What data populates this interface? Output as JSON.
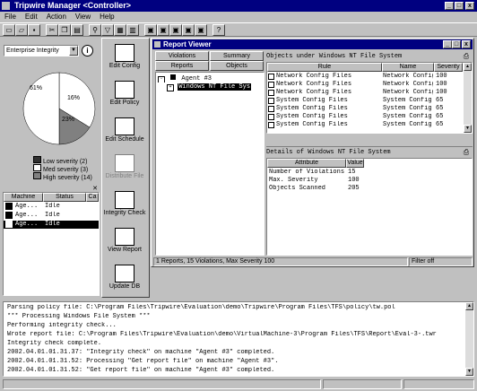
{
  "window": {
    "title": "Tripwire Manager <Controller>"
  },
  "menu": [
    "File",
    "Edit",
    "Action",
    "View",
    "Help"
  ],
  "filter": {
    "value": "Enterprise Integrity"
  },
  "pie": {
    "labels": [
      "61%",
      "16%",
      "23%"
    ],
    "legend": [
      {
        "label": "Low severity (2)",
        "color": "#303030"
      },
      {
        "label": "Med severity (3)",
        "color": "#ffffff"
      },
      {
        "label": "High severity (14)",
        "color": "#808080"
      }
    ]
  },
  "machines": {
    "columns": [
      "Machine",
      "Status",
      "Ca"
    ],
    "rows": [
      {
        "name": "Age...",
        "status": "Idle"
      },
      {
        "name": "Age...",
        "status": "Idle"
      },
      {
        "name": "Age...",
        "status": "Idle"
      }
    ]
  },
  "nav": [
    {
      "label": "Edit Config"
    },
    {
      "label": "Edit Policy"
    },
    {
      "label": "Edit Schedule"
    },
    {
      "label": "Distribute File"
    },
    {
      "label": "Integrity Check"
    },
    {
      "label": "View Report"
    },
    {
      "label": "Update DB"
    }
  ],
  "report": {
    "title": "Report Viewer",
    "tabs": [
      "Violations",
      "Summary",
      "Reports",
      "Objects"
    ],
    "tree": [
      {
        "label": "Agent #3"
      },
      {
        "label": "Windows NT File Sys"
      }
    ],
    "objects_title": "Objects under Windows NT File System",
    "objects_columns": [
      "Rule",
      "Name",
      "Severity"
    ],
    "objects_rows": [
      {
        "rule": "Network Config Files",
        "name": "Network Config Files",
        "sev": "100"
      },
      {
        "rule": "Network Config Files",
        "name": "Network Config Files",
        "sev": "100"
      },
      {
        "rule": "Network Config Files",
        "name": "Network Config Files",
        "sev": "100"
      },
      {
        "rule": "System Config Files",
        "name": "System Config Files",
        "sev": "65"
      },
      {
        "rule": "System Config Files",
        "name": "System Config Files",
        "sev": "65"
      },
      {
        "rule": "System Config Files",
        "name": "System Config Files",
        "sev": "65"
      },
      {
        "rule": "System Config Files",
        "name": "System Config Files",
        "sev": "65"
      }
    ],
    "details_title": "Details of Windows NT File System",
    "details_columns": [
      "Attribute",
      "Value"
    ],
    "details_rows": [
      {
        "attr": "Number of Violations",
        "val": "15"
      },
      {
        "attr": "Max. Severity",
        "val": "100"
      },
      {
        "attr": "Objects Scanned",
        "val": "205"
      }
    ],
    "status": "1 Reports, 15 Violations, Max Severity 100",
    "filter_label": "Filter off"
  },
  "log": [
    "Parsing policy file: C:\\Program Files\\Tripwire\\Evaluation\\demo\\Tripwire\\Program Files\\TFS\\policy\\tw.pol",
    "*** Processing Windows File System ***",
    "Performing integrity check...",
    "Wrote report file: C:\\Program Files\\Tripwire\\Evaluation\\demo\\VirtualMachine-3\\Program Files\\TFS\\Report\\Eval-3-.twr",
    "Integrity check complete.",
    "2002.04.01.01.31.37: \"Integrity check\" on machine \"Agent #3\" completed.",
    "2002.04.01.01.31.52: Processing \"Get report file\" on machine \"Agent #3\".",
    "2002.04.01.01.31.52: \"Get report file\" on machine \"Agent #3\" completed."
  ]
}
